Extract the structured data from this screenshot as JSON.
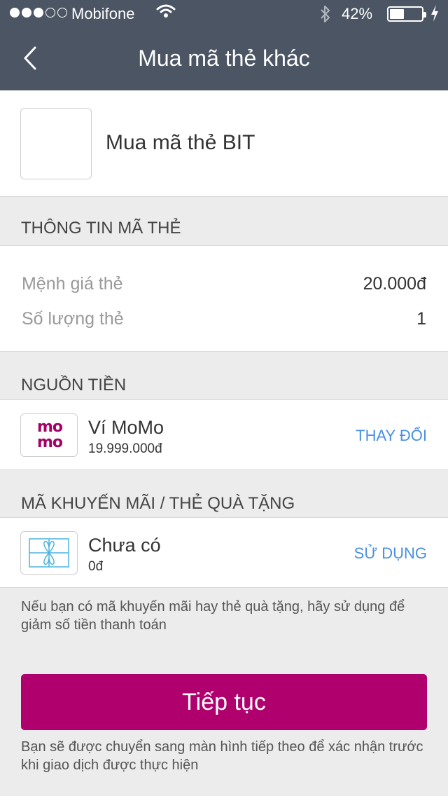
{
  "status_bar": {
    "carrier": "Mobifone",
    "battery_percent": "42%",
    "signal_bars_filled": 3
  },
  "nav": {
    "title": "Mua mã thẻ khác"
  },
  "product": {
    "name": "Mua mã thẻ BIT"
  },
  "card_info": {
    "header": "THÔNG TIN MÃ THẺ",
    "rows": [
      {
        "label": "Mệnh giá thẻ",
        "value": "20.000đ"
      },
      {
        "label": "Số lượng thẻ",
        "value": "1"
      }
    ]
  },
  "funding": {
    "header": "NGUỒN TIỀN",
    "logo_text_line1": "mo",
    "logo_text_line2": "mo",
    "name": "Ví MoMo",
    "amount": "19.999.000đ",
    "action": "THAY ĐỔI"
  },
  "promo": {
    "header": "MÃ KHUYẾN MÃI / THẺ QUÀ TẶNG",
    "name": "Chưa có",
    "amount": "0đ",
    "action": "SỬ DỤNG",
    "note": "Nếu bạn có mã khuyến mãi hay thẻ quà tặng, hãy sử dụng để giảm số tiền thanh toán"
  },
  "cta": {
    "label": "Tiếp tục",
    "note": "Bạn sẽ được chuyển sang màn hình tiếp theo để xác nhận trước khi giao dịch được thực hiện"
  },
  "colors": {
    "header_bg": "#4b5563",
    "brand": "#b0006d",
    "link": "#4a90e2"
  }
}
